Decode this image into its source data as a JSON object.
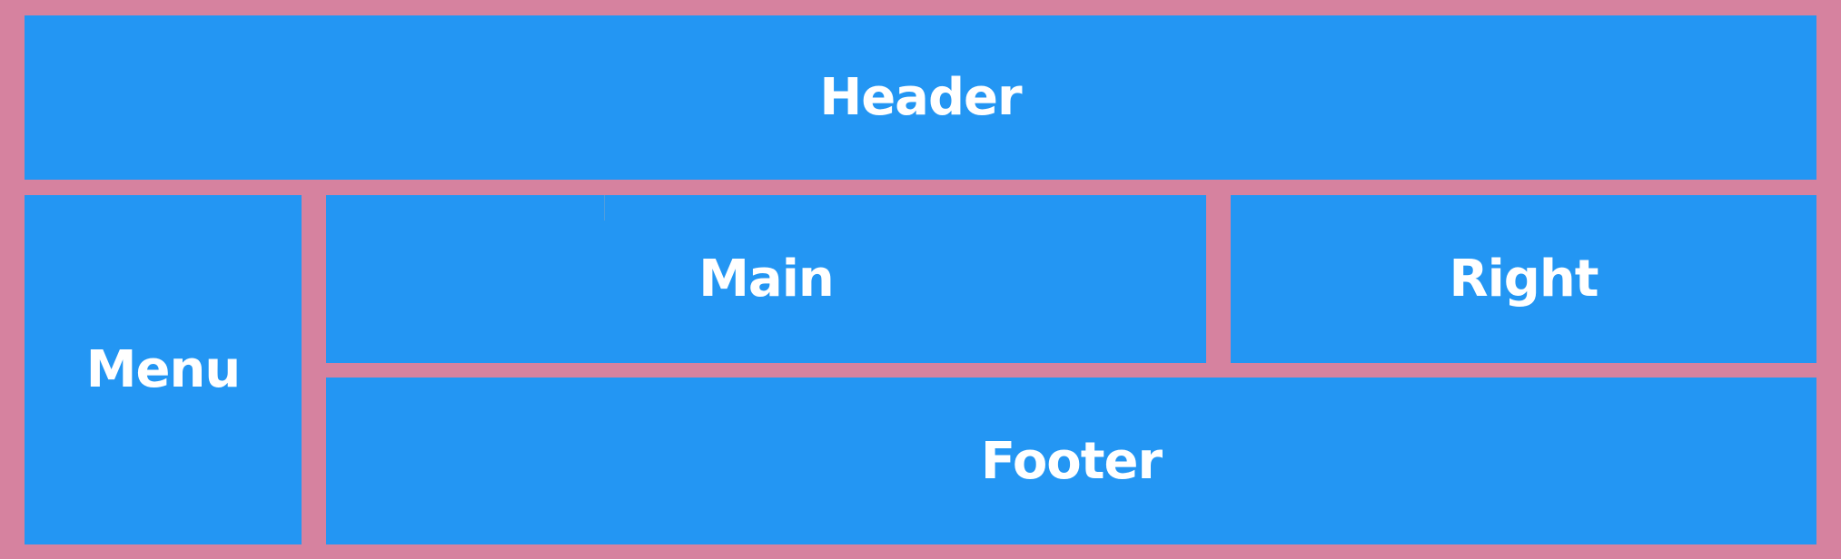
{
  "colors": {
    "background": "#d6829f",
    "panel": "#2396f3",
    "text": "#ffffff"
  },
  "layout": {
    "header": {
      "label": "Header"
    },
    "menu": {
      "label": "Menu"
    },
    "main": {
      "label": "Main"
    },
    "right": {
      "label": "Right"
    },
    "footer": {
      "label": "Footer"
    }
  }
}
